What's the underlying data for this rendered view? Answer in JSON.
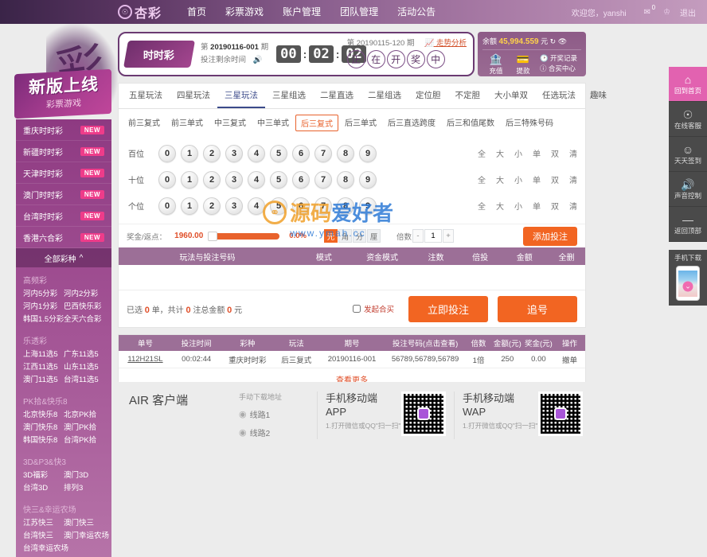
{
  "header": {
    "logo_text": "杏彩",
    "logo_icon": "circle-logo-icon",
    "nav": [
      {
        "label": "首页"
      },
      {
        "label": "彩票游戏"
      },
      {
        "label": "账户管理"
      },
      {
        "label": "团队管理"
      },
      {
        "label": "活动公告"
      }
    ],
    "welcome": "欢迎您，yanshi",
    "mail_badge": "0",
    "logout": "退出"
  },
  "promo": {
    "title": "新版上线",
    "subtitle": "彩票游戏"
  },
  "sidebar": {
    "hot": [
      {
        "label": "重庆时时彩",
        "badge": "NEW"
      },
      {
        "label": "新疆时时彩",
        "badge": "NEW"
      },
      {
        "label": "天津时时彩",
        "badge": "NEW"
      },
      {
        "label": "澳门时时彩",
        "badge": "NEW"
      },
      {
        "label": "台湾时时彩",
        "badge": "NEW"
      },
      {
        "label": "香港六合彩",
        "badge": "NEW"
      }
    ],
    "all_label": "全部彩种",
    "categories": [
      {
        "title": "高频彩",
        "items": [
          "河内5分彩",
          "河内2分彩",
          "河内1分彩",
          "巴西快乐彩",
          "韩国1.5分彩",
          "全天六合彩"
        ]
      },
      {
        "title": "乐透彩",
        "items": [
          "上海11选5",
          "广东11选5",
          "江西11选5",
          "山东11选5",
          "澳门11选5",
          "台湾11选5"
        ]
      },
      {
        "title": "PK拾&快乐8",
        "items": [
          "北京快乐8",
          "北京PK拾",
          "澳门快乐8",
          "澳门PK拾",
          "韩国快乐8",
          "台湾PK拾"
        ]
      },
      {
        "title": "3D&P3&快3",
        "items": [
          "3D福彩",
          "澳门3D",
          "台湾3D",
          "排列3"
        ]
      },
      {
        "title": "快三&幸运农场",
        "items": [
          "江苏快三",
          "澳门快三",
          "台湾快三",
          "澳门幸运农场",
          "台湾幸运农场"
        ]
      }
    ]
  },
  "countdown": {
    "lottery_name": "时时彩",
    "issue_label_prefix": "第",
    "issue": "20190116-001",
    "issue_label_suffix": "期",
    "remaining_label": "投注剩余时间",
    "hours": "00",
    "minutes": "02",
    "seconds": "02",
    "prev_issue_text": "第 20190115-120 期",
    "trend_label": "走势分析",
    "drawing_chars": [
      "正",
      "在",
      "开",
      "奖",
      "中"
    ]
  },
  "balance": {
    "label": "余额",
    "amount": "45,994.559",
    "unit": "元",
    "recharge": "充值",
    "withdraw": "提款",
    "draw_records": "开奖记录",
    "coop_center": "合买中心"
  },
  "tabs": [
    {
      "label": "五星玩法",
      "active": false
    },
    {
      "label": "四星玩法",
      "active": false
    },
    {
      "label": "三星玩法",
      "active": true
    },
    {
      "label": "三星组选",
      "active": false
    },
    {
      "label": "二星直选",
      "active": false
    },
    {
      "label": "二星组选",
      "active": false
    },
    {
      "label": "定位胆",
      "active": false
    },
    {
      "label": "不定胆",
      "active": false
    },
    {
      "label": "大小单双",
      "active": false
    },
    {
      "label": "任选玩法",
      "active": false
    },
    {
      "label": "趣味",
      "active": false
    }
  ],
  "subtabs": [
    {
      "label": "前三复式",
      "active": false
    },
    {
      "label": "前三单式",
      "active": false
    },
    {
      "label": "中三复式",
      "active": false
    },
    {
      "label": "中三单式",
      "active": false
    },
    {
      "label": "后三复式",
      "active": true
    },
    {
      "label": "后三单式",
      "active": false
    },
    {
      "label": "后三直选跨度",
      "active": false
    },
    {
      "label": "后三和值尾数",
      "active": false
    },
    {
      "label": "后三特殊号码",
      "active": false
    }
  ],
  "pickrows": [
    {
      "label": "百位",
      "numbers": [
        "0",
        "1",
        "2",
        "3",
        "4",
        "5",
        "6",
        "7",
        "8",
        "9"
      ]
    },
    {
      "label": "十位",
      "numbers": [
        "0",
        "1",
        "2",
        "3",
        "4",
        "5",
        "6",
        "7",
        "8",
        "9"
      ]
    },
    {
      "label": "个位",
      "numbers": [
        "0",
        "1",
        "2",
        "3",
        "4",
        "5",
        "6",
        "7",
        "8",
        "9"
      ]
    }
  ],
  "quick_links": [
    "全",
    "大",
    "小",
    "单",
    "双",
    "清"
  ],
  "betbar": {
    "prize_label": "奖金/返点：",
    "prize_value": "1960.00",
    "percent": "0.0%",
    "units": [
      {
        "label": "元",
        "active": true
      },
      {
        "label": "角",
        "active": false
      },
      {
        "label": "分",
        "active": false
      },
      {
        "label": "厘",
        "active": false
      }
    ],
    "multiplier_label": "倍数",
    "multiplier_value": "1",
    "minus": "-",
    "plus": "+",
    "add_bet": "添加投注"
  },
  "bet_table": {
    "headers": [
      "玩法与投注号码",
      "模式",
      "资金模式",
      "注数",
      "倍投",
      "金额",
      "全删"
    ],
    "rows": []
  },
  "summary": {
    "text_prefix": "已选",
    "orders": "0",
    "text_mid1": "单，共计",
    "notes": "0",
    "text_mid2": "注总金额",
    "amount": "0",
    "text_suffix": "元",
    "coop_label": "发起合买",
    "submit": "立即投注",
    "chase": "追号"
  },
  "history": {
    "headers": [
      "单号",
      "投注时间",
      "彩种",
      "玩法",
      "期号",
      "投注号码(点击查看)",
      "倍数",
      "金额(元)",
      "奖金(元)",
      "操作"
    ],
    "rows": [
      {
        "order_no": "112H21SL",
        "time": "00:02:44",
        "lottery": "重庆时时彩",
        "play": "后三复式",
        "issue": "20190116-001",
        "numbers": "56789,56789,56789",
        "multiplier": "1倍",
        "amount": "250",
        "prize": "0.00",
        "action": "撤单"
      }
    ],
    "more": "查看更多"
  },
  "footer": {
    "air_title": "AIR 客户端",
    "download_label": "手动下载地址",
    "lines": [
      "线路1",
      "线路2"
    ],
    "app": {
      "title_1": "手机移动端",
      "title_2": "APP",
      "desc": "1.打开微信或QQ\"扫一扫\""
    },
    "wap": {
      "title_1": "手机移动端",
      "title_2": "WAP",
      "desc": "1.打开微信或QQ\"扫一扫\""
    }
  },
  "rail": [
    {
      "label": "回到首页",
      "icon": "home-icon",
      "active": true
    },
    {
      "label": "在线客服",
      "icon": "headset-icon",
      "active": false
    },
    {
      "label": "天天签到",
      "icon": "smiley-icon",
      "active": false
    },
    {
      "label": "声音控制",
      "icon": "speaker-icon",
      "active": false
    },
    {
      "label": "返回顶部",
      "icon": "arrow-up-icon",
      "active": false
    }
  ],
  "rail_phone": {
    "label": "手机下载"
  },
  "watermark": {
    "text_1": "源码",
    "text_2": "爱好者",
    "url": "www.ymah.cc"
  },
  "colors": {
    "brand_purple": "#8e3a82",
    "accent_orange": "#f26522",
    "badge_pink": "#ee3c8a",
    "table_header": "#9c6f97"
  }
}
